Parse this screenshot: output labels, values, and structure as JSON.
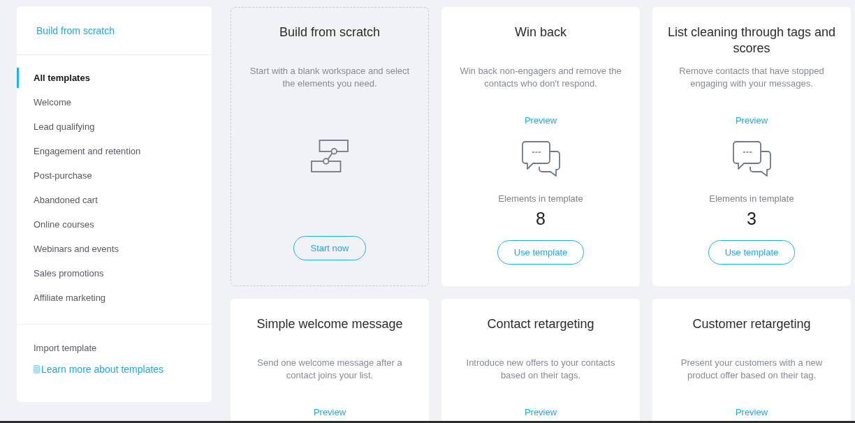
{
  "sidebar": {
    "build_link": "Build from scratch",
    "categories": [
      {
        "label": "All templates",
        "selected": true
      },
      {
        "label": "Welcome",
        "selected": false
      },
      {
        "label": "Lead qualifying",
        "selected": false
      },
      {
        "label": "Engagement and retention",
        "selected": false
      },
      {
        "label": "Post-purchase",
        "selected": false
      },
      {
        "label": "Abandoned cart",
        "selected": false
      },
      {
        "label": "Online courses",
        "selected": false
      },
      {
        "label": "Webinars and events",
        "selected": false
      },
      {
        "label": "Sales promotions",
        "selected": false
      },
      {
        "label": "Affiliate marketing",
        "selected": false
      }
    ],
    "import": "Import template",
    "learn_more": "Learn more about templates"
  },
  "templates": [
    {
      "kind": "scratch",
      "title": "Build from scratch",
      "description": "Start with a blank workspace and select the elements you need.",
      "button": "Start now"
    },
    {
      "kind": "template",
      "title": "Win back",
      "description": "Win back non-engagers and remove the contacts who don't respond.",
      "preview": "Preview",
      "elements_label": "Elements in template",
      "elements_count": "8",
      "button": "Use template"
    },
    {
      "kind": "template",
      "title": "List cleaning through tags and scores",
      "description": "Remove contacts that have stopped engaging with your messages.",
      "preview": "Preview",
      "elements_label": "Elements in template",
      "elements_count": "3",
      "button": "Use template"
    },
    {
      "kind": "template",
      "title": "Simple welcome message",
      "description": "Send one welcome message after a contact joins your list.",
      "preview": "Preview"
    },
    {
      "kind": "template",
      "title": "Contact retargeting",
      "description": "Introduce new offers to your contacts based on their tags.",
      "preview": "Preview"
    },
    {
      "kind": "template",
      "title": "Customer retargeting",
      "description": "Present your customers with a new product offer based on their tag.",
      "preview": "Preview"
    }
  ]
}
